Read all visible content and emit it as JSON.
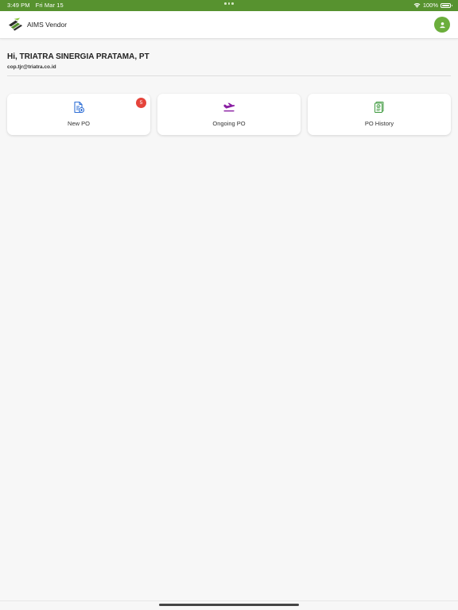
{
  "status_bar": {
    "time": "3:49 PM",
    "date": "Fri Mar 15",
    "battery": "100%",
    "battery_level": 1.0
  },
  "app_bar": {
    "title": "AIMS Vendor",
    "logo_icon": "aims-logo-icon",
    "profile_icon": "user-icon"
  },
  "greeting": {
    "text": "Hi, TRIATRA SINERGIA PRATAMA, PT",
    "email": "cop.tjr@triatra.co.id"
  },
  "menu": [
    {
      "label": "New PO",
      "icon": "new-document-icon",
      "badge": "5",
      "icon_color": "#2f6fd6"
    },
    {
      "label": "Ongoing PO",
      "icon": "plane-icon",
      "icon_color": "#8a1fa3"
    },
    {
      "label": "PO History",
      "icon": "history-document-icon",
      "icon_color": "#3f9a3f"
    }
  ],
  "colors": {
    "brand_green": "#57922f",
    "avatar_green": "#6bae3c",
    "badge_red": "#e5443b"
  }
}
